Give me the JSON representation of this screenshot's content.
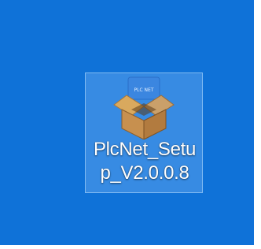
{
  "desktop": {
    "background_color": "#0f72d8",
    "items": [
      {
        "icon": "package-box-icon",
        "icon_tag_text": "PLC NET",
        "label_line1": "PlcNet_Setu",
        "label_line2": "p_V2.0.0.8",
        "selected": true
      }
    ]
  }
}
